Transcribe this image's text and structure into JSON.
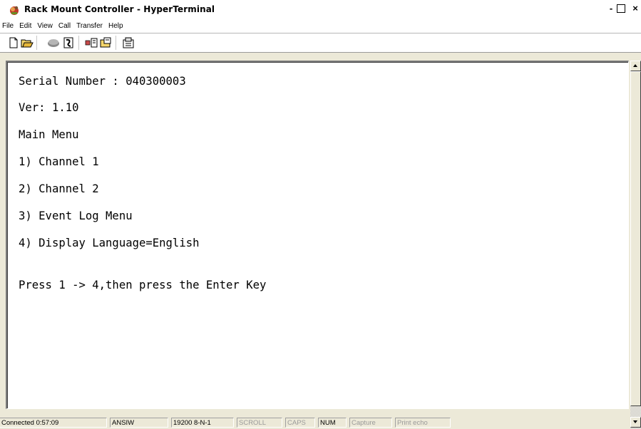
{
  "window": {
    "title": "Rack Mount Controller - HyperTerminal",
    "controls": {
      "minimize": "-",
      "close": "×"
    }
  },
  "menu": [
    "File",
    "Edit",
    "View",
    "Call",
    "Transfer",
    "Help"
  ],
  "toolbar": {
    "icons": [
      "new-connection-icon",
      "open-icon",
      "disconnect-icon",
      "dial-icon",
      "send-icon",
      "receive-icon",
      "properties-icon"
    ]
  },
  "terminal": {
    "lines": [
      "Serial Number : 040300003",
      "Ver: 1.10",
      "Main Menu",
      "1) Channel 1",
      "2) Channel 2",
      "3) Event Log Menu",
      "4) Display Language=English",
      "Press 1 -> 4,then press the Enter Key"
    ]
  },
  "status": {
    "connected": "Connected 0:57:09",
    "emulation": "ANSIW",
    "port_settings": "19200 8-N-1",
    "scroll": "SCROLL",
    "caps": "CAPS",
    "num": "NUM",
    "capture": "Capture",
    "print_echo": "Print echo"
  },
  "colors": {
    "chrome": "#ece9d8",
    "terminal_bg": "#ffffff",
    "terminal_text": "#000000",
    "dim_status": "#9a9a9a"
  }
}
